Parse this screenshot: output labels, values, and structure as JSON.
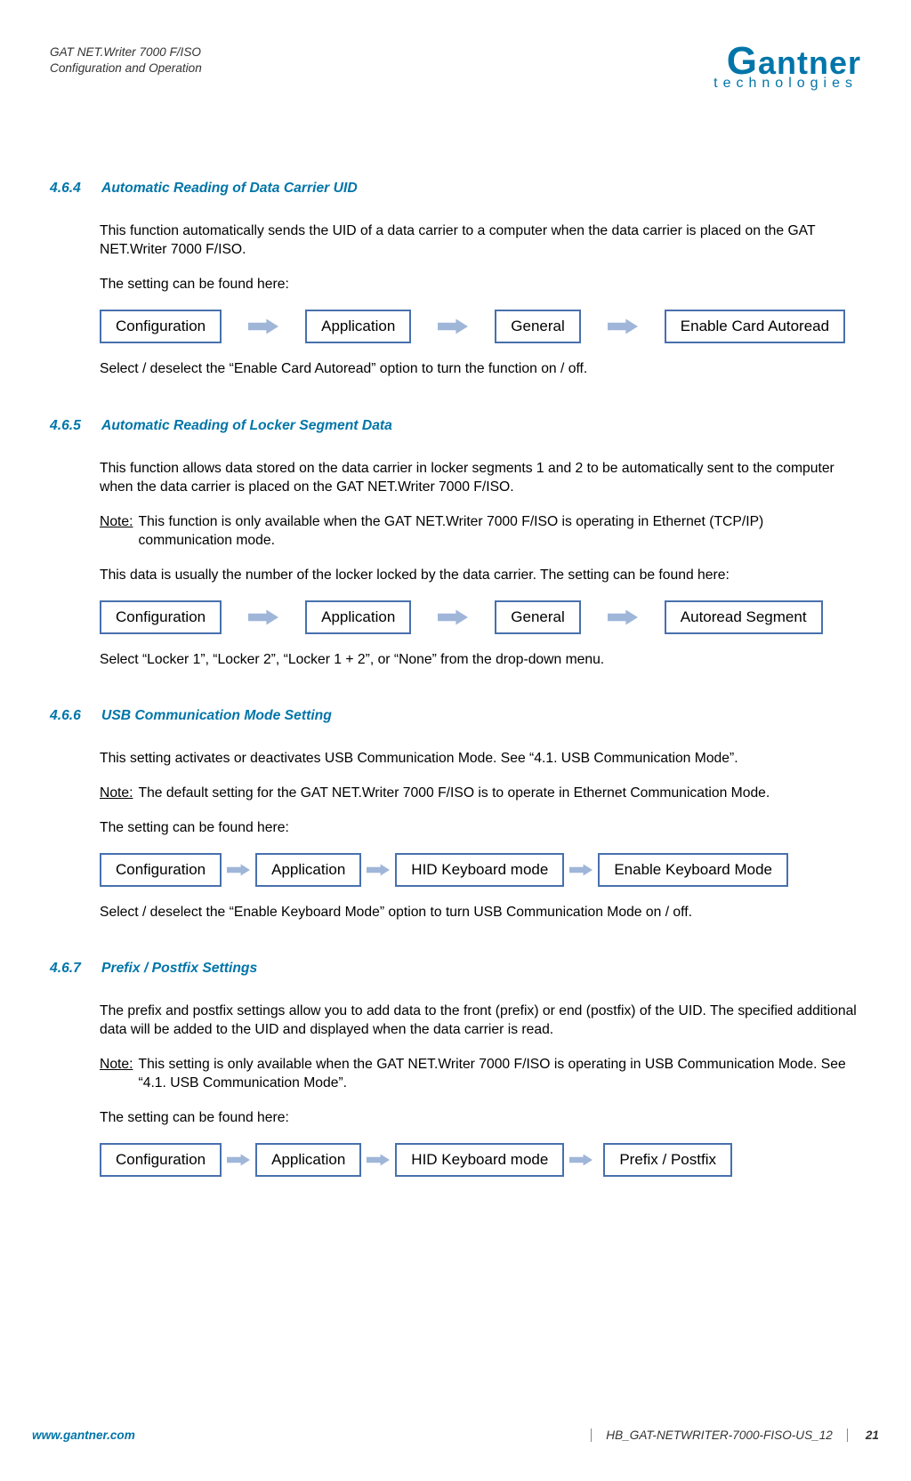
{
  "header": {
    "line1": "GAT NET.Writer 7000 F/ISO",
    "line2": "Configuration and Operation"
  },
  "logo": {
    "brand": "Gantner",
    "sub": "technologies"
  },
  "sections": {
    "s1": {
      "num": "4.6.4",
      "title": "Automatic Reading of Data Carrier UID",
      "p1": "This function automatically sends the UID of a data carrier to a computer when the data carrier is placed on the GAT NET.Writer 7000 F/ISO.",
      "p2": "The setting can be found here:",
      "nav": [
        "Configuration",
        "Application",
        "General",
        "Enable Card Autoread"
      ],
      "p3": "Select / deselect the “Enable Card Autoread” option to turn the function on / off."
    },
    "s2": {
      "num": "4.6.5",
      "title": "Automatic Reading of Locker Segment Data",
      "p1": "This function allows data stored on the data carrier in locker segments 1 and 2 to be automatically sent to the computer when the data carrier is placed on the GAT NET.Writer 7000 F/ISO.",
      "noteLabel": "Note:",
      "noteText": "This function is only available when the GAT NET.Writer 7000 F/ISO is operating in Ethernet (TCP/IP) communication mode.",
      "p2": "This data is usually the number of the locker locked by the data carrier. The setting can be found here:",
      "nav": [
        "Configuration",
        "Application",
        "General",
        "Autoread Segment"
      ],
      "p3": "Select “Locker 1”, “Locker 2”, “Locker 1 + 2”, or “None” from the drop-down menu."
    },
    "s3": {
      "num": "4.6.6",
      "title": "USB Communication Mode Setting",
      "p1": "This setting activates or deactivates USB Communication Mode. See “4.1. USB Communication Mode”.",
      "noteLabel": "Note:",
      "noteText": "The default setting for the GAT NET.Writer 7000 F/ISO is to operate in Ethernet Communication Mode.",
      "p2": "The setting can be found here:",
      "nav": [
        "Configuration",
        "Application",
        "HID Keyboard mode",
        "Enable Keyboard Mode"
      ],
      "p3": "Select / deselect the “Enable Keyboard Mode” option to turn USB Communication Mode on / off."
    },
    "s4": {
      "num": "4.6.7",
      "title": "Prefix / Postfix Settings",
      "p1": "The prefix and postfix settings allow you to add data to the front (prefix) or end (postfix) of the UID. The specified additional data will be added to the UID and displayed when the data carrier is read.",
      "noteLabel": "Note:",
      "noteText": "This setting is only available when the GAT NET.Writer 7000 F/ISO is operating in USB Communication Mode. See “4.1. USB Communication Mode”.",
      "p2": "The setting can be found here:",
      "nav": [
        "Configuration",
        "Application",
        "HID Keyboard mode",
        "Prefix / Postfix"
      ]
    }
  },
  "footer": {
    "url": "www.gantner.com",
    "doc": "HB_GAT-NETWRITER-7000-FISO-US_12",
    "page": "21"
  }
}
